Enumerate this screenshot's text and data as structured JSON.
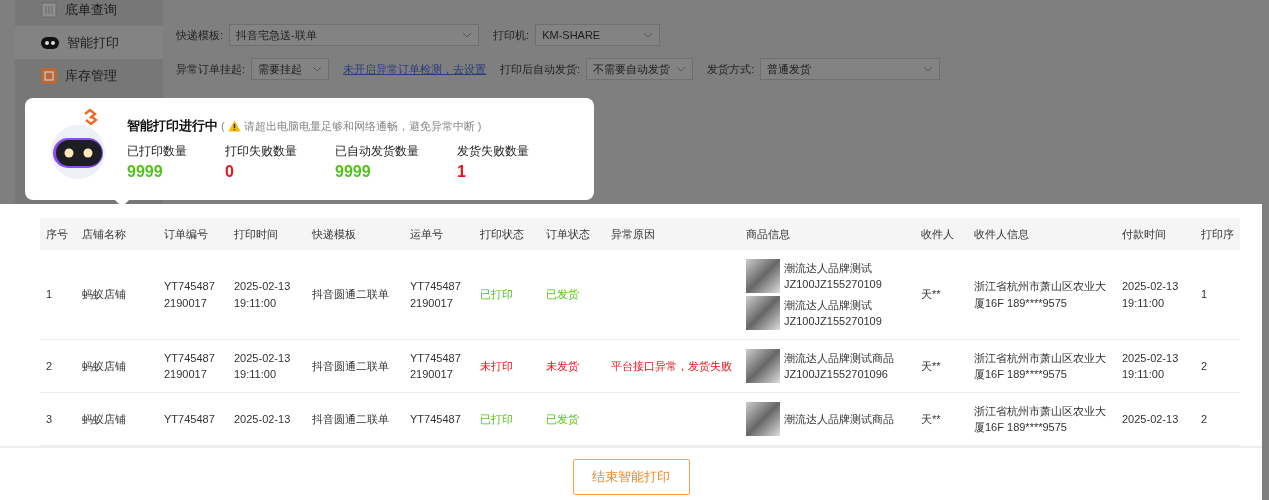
{
  "sidebar": {
    "items": [
      {
        "label": "底单查询",
        "selected": false
      },
      {
        "label": "智能打印",
        "selected": true
      },
      {
        "label": "库存管理",
        "selected": false
      }
    ]
  },
  "filters": {
    "line_1": [
      {
        "kind": "select",
        "label": "快递模板:",
        "value": "抖音宅急送-联单"
      },
      {
        "kind": "select",
        "label": "打印机:",
        "value": "KM-SHARE"
      }
    ],
    "line_2": [
      {
        "kind": "select",
        "label": "异常订单挂起:",
        "value": "需要挂起"
      },
      {
        "kind": "link",
        "value": "未开启异常订单检测，去设置"
      },
      {
        "kind": "select",
        "label": "打印后自动发货:",
        "value": "不需要自动发货"
      },
      {
        "kind": "select",
        "label": "发货方式:",
        "value": "普通发货"
      }
    ]
  },
  "popup": {
    "title": "智能打印进行中",
    "notice_open": "(",
    "notice": "请超出电脑电量足够和网络通畅，避免异常中断",
    "notice_close": ")",
    "stats": [
      {
        "label": "已打印数量",
        "value": "9999",
        "color": "#52c41a"
      },
      {
        "label": "打印失败数量",
        "value": "0",
        "color": "#e8141b"
      },
      {
        "label": "已自动发货数量",
        "value": "9999",
        "color": "#52c41a"
      },
      {
        "label": "发货失败数量",
        "value": "1",
        "color": "#e8141b"
      }
    ]
  },
  "table": {
    "columns": [
      "序号",
      "店铺名称",
      "订单编号",
      "打印时间",
      "快递模板",
      "运单号",
      "打印状态",
      "订单状态",
      "异常原因",
      "商品信息",
      "收件人",
      "收件人信息",
      "付款时间",
      "打印序"
    ],
    "rows": [
      {
        "index": "1",
        "shop": "蚂蚁店铺",
        "order_no": "YT745487 2190017",
        "print_time": "2025-02-13 19:11:00",
        "template": "抖音圆通二联单",
        "waybill": "YT745487 2190017",
        "print_status": {
          "text": "已打印",
          "ok": true
        },
        "order_status": {
          "text": "已发货",
          "ok": true
        },
        "products": [
          {
            "name": "潮流达人品牌测试",
            "sku": "JZ100JZ155270109"
          },
          {
            "name": "潮流达人品牌测试",
            "sku": "JZ100JZ155270109"
          }
        ],
        "receiver": "天**",
        "address": "浙江省杭州市萧山区农业大厦16F 189****9575",
        "pay_time": "2025-02-13 19:11:00",
        "print_no": "1"
      },
      {
        "index": "2",
        "shop": "蚂蚁店铺",
        "order_no": "YT745487 2190017",
        "print_time": "2025-02-13 19:11:00",
        "template": "抖音圆通二联单",
        "waybill": "YT745487 2190017",
        "print_status": {
          "text": "未打印",
          "ok": false
        },
        "order_status": {
          "text": "未发货",
          "ok": false
        },
        "exception": "平台接口异常，发货失败",
        "products": [
          {
            "name": "潮流达人品牌测试商品",
            "sku": "JZ100JZ1552701096"
          }
        ],
        "receiver": "天**",
        "address": "浙江省杭州市萧山区农业大厦16F 189****9575",
        "pay_time": "2025-02-13 19:11:00",
        "print_no": "2"
      },
      {
        "index": "3",
        "shop": "蚂蚁店铺",
        "order_no": "YT745487",
        "print_time": "2025-02-13",
        "template": "抖音圆通二联单",
        "waybill": "YT745487",
        "print_status": {
          "text": "已打印",
          "ok": true
        },
        "order_status": {
          "text": "已发货",
          "ok": true
        },
        "products": [
          {
            "name": "潮流达人品牌测试商品"
          }
        ],
        "receiver": "天**",
        "address": "浙江省杭州市萧山区农业大厦16F 189****9575",
        "pay_time": "2025-02-13",
        "print_no": "2"
      }
    ]
  },
  "footer": {
    "button": "结束智能打印"
  }
}
